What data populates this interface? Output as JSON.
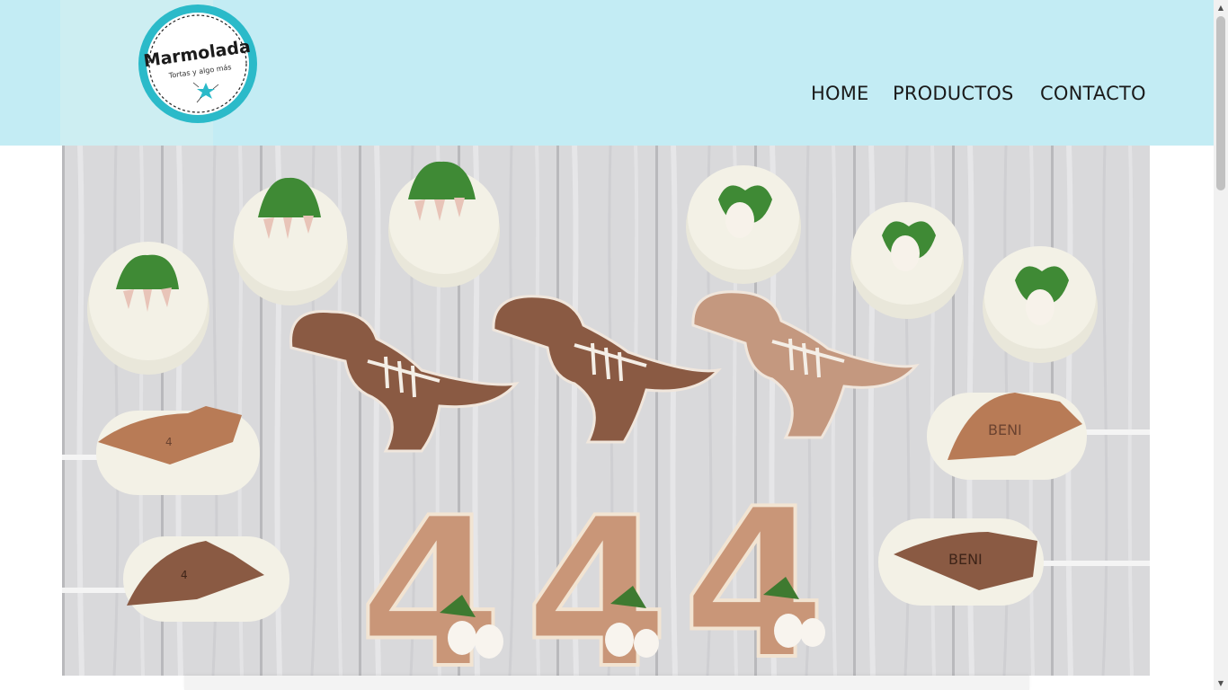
{
  "brand": {
    "name": "Marmolada",
    "tagline": "Tortas y algo más"
  },
  "nav": {
    "items": [
      {
        "label": "HOME"
      },
      {
        "label": "PRODUCTOS"
      },
      {
        "label": "CONTACTO"
      }
    ]
  },
  "hero": {
    "name_on_treats": "BENI",
    "number_on_treats": "4",
    "big_numbers": [
      "4",
      "4",
      "4"
    ]
  },
  "colors": {
    "header_bg": "#c3ecf4",
    "logo_ring": "#2bbac9",
    "nav_text": "#1a1a1a"
  },
  "icons": {
    "logo_star": "star-icon",
    "scroll_up": "triangle-up-icon",
    "scroll_down": "triangle-down-icon"
  }
}
